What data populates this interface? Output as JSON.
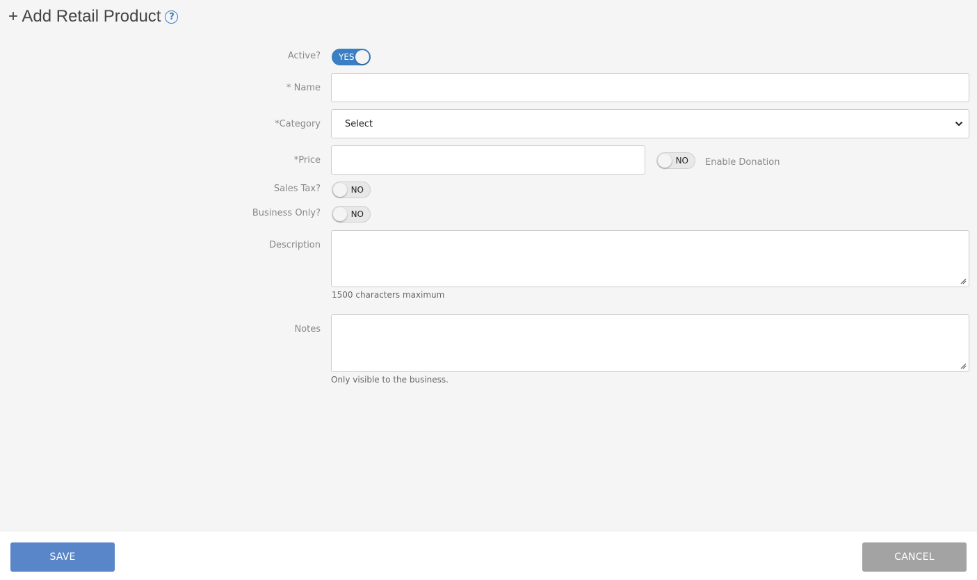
{
  "header": {
    "title": "+ Add Retail Product",
    "help_icon": "?"
  },
  "form": {
    "active": {
      "label": "Active?",
      "state": "YES",
      "on": true
    },
    "name": {
      "label": "* Name",
      "value": "",
      "placeholder": ""
    },
    "category": {
      "label": "*Category",
      "selected": "Select"
    },
    "price": {
      "label": "*Price",
      "value": "",
      "placeholder": ""
    },
    "enable_donation": {
      "state": "NO",
      "on": false,
      "label": "Enable Donation"
    },
    "sales_tax": {
      "label": "Sales Tax?",
      "state": "NO",
      "on": false
    },
    "business_only": {
      "label": "Business Only?",
      "state": "NO",
      "on": false
    },
    "description": {
      "label": "Description",
      "value": "",
      "hint": "1500 characters maximum"
    },
    "notes": {
      "label": "Notes",
      "value": "",
      "hint": "Only visible to the business."
    }
  },
  "footer": {
    "save_label": "SAVE",
    "cancel_label": "CANCEL"
  },
  "colors": {
    "accent": "#3a7fc4",
    "save_button": "#5886c8",
    "cancel_button": "#a3a3a3",
    "background": "#f5f5f5"
  }
}
